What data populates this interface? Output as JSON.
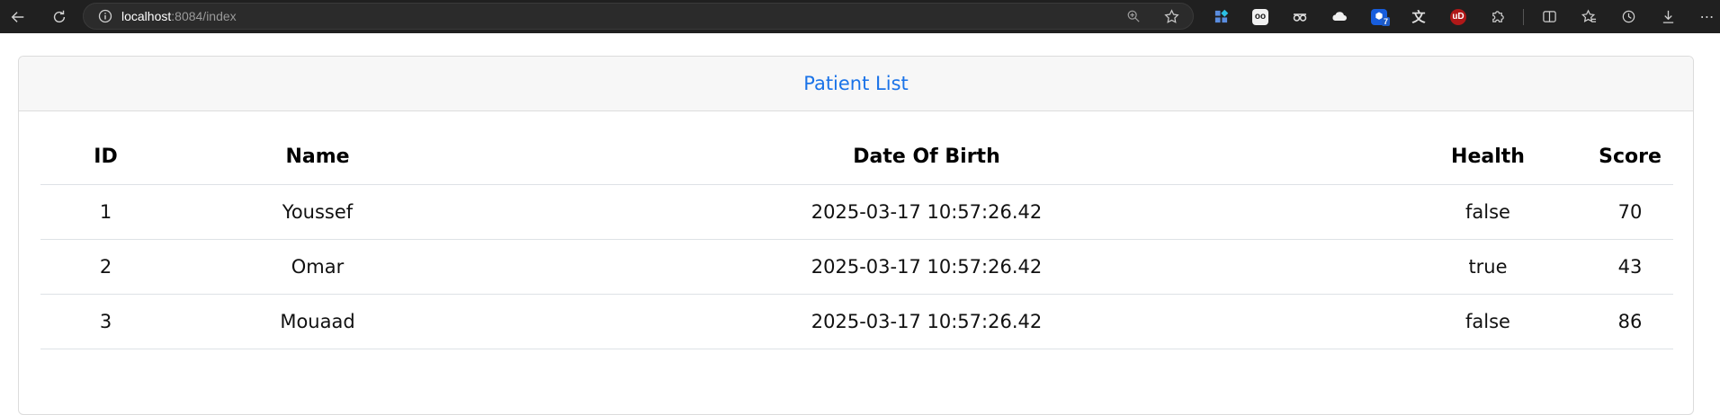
{
  "browser": {
    "url_host": "localhost",
    "url_rest": ":8084/index",
    "toolbar_icons": [
      "extension-pin-icon",
      "ghost-extension-icon",
      "spy-extension-icon",
      "cloud-extension-icon",
      "bitwarden-icon",
      "translate-extension-icon",
      "ublock-icon",
      "extensions-puzzle-icon",
      "split-screen-icon",
      "favorites-icon",
      "history-icon",
      "downloads-icon",
      "more-menu-icon"
    ],
    "bitwarden_badge": "7",
    "ublock_label": "uD"
  },
  "page": {
    "card_title": "Patient List",
    "table": {
      "headers": [
        "ID",
        "Name",
        "Date Of Birth",
        "Health",
        "Score"
      ],
      "rows": [
        [
          "1",
          "Youssef",
          "2025-03-17 10:57:26.42",
          "false",
          "70"
        ],
        [
          "2",
          "Omar",
          "2025-03-17 10:57:26.42",
          "true",
          "43"
        ],
        [
          "3",
          "Mouaad",
          "2025-03-17 10:57:26.42",
          "false",
          "86"
        ]
      ]
    }
  },
  "colors": {
    "accent": "#1a73e8",
    "chrome_bg": "#202020",
    "header_bg": "#f7f7f7"
  }
}
